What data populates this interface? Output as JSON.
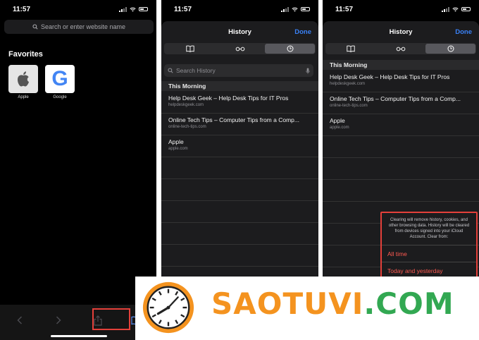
{
  "status": {
    "time": "11:57"
  },
  "browser": {
    "address_placeholder": "Search or enter website name",
    "favorites_title": "Favorites",
    "favorites": [
      {
        "label": "Apple",
        "icon": "apple-logo-icon"
      },
      {
        "label": "Google",
        "icon": "google-logo-icon",
        "glyph": "G"
      }
    ],
    "toolbar": [
      "back-icon",
      "forward-icon",
      "share-icon",
      "bookmarks-icon"
    ]
  },
  "history": {
    "title": "History",
    "done_label": "Done",
    "segments": [
      "bookmarks-icon",
      "reading-list-icon",
      "history-clock-icon"
    ],
    "search_placeholder": "Search History",
    "section_title": "This Morning",
    "items": [
      {
        "title": "Help Desk Geek – Help Desk Tips for IT Pros",
        "url": "helpdeskgeek.com"
      },
      {
        "title": "Online Tech Tips – Computer Tips from a Comp...",
        "url": "online-tech-tips.com"
      },
      {
        "title": "Apple",
        "url": "apple.com"
      }
    ],
    "items_p3": [
      {
        "title": "Help Desk Geek – Help Desk Tips for IT Pros",
        "url": "helpdeskgeek.com"
      },
      {
        "title": "Online Tech Tips – Computer Tips from a Comp...",
        "url": "online-tech-tips.com"
      },
      {
        "title": "Apple",
        "url": "apple.com"
      }
    ]
  },
  "clear_popup": {
    "message": "Clearing will remove history, cookies, and other browsing data. History will be cleared from devices signed into your iCloud Account. Clear from:",
    "options": [
      "All time",
      "Today and yesterday"
    ]
  },
  "watermark": {
    "text_a": "SAOTUVI",
    "text_b": ".COM"
  },
  "colors": {
    "accent": "#3a82f7",
    "highlight": "#e4403a",
    "destructive": "#ff5a51",
    "brand_orange": "#f4931f",
    "brand_green": "#32a852"
  }
}
